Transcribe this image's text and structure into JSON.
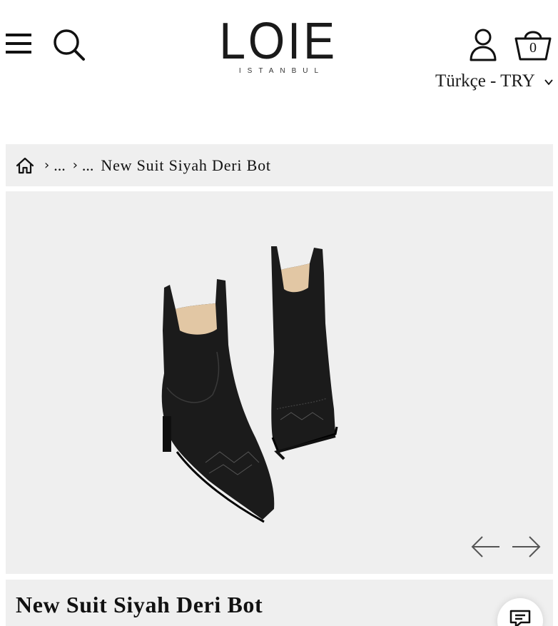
{
  "header": {
    "brand": "LOIE",
    "brand_sub": "ISTANBUL",
    "language_currency": "Türkçe - TRY",
    "cart_count": "0",
    "icons": {
      "menu": "hamburger-menu-icon",
      "search": "search-icon",
      "account": "user-icon",
      "cart": "shopping-basket-icon"
    }
  },
  "breadcrumb": {
    "home_icon": "home-icon",
    "items": [
      "...",
      "...",
      "New Suit Siyah Deri Bot"
    ]
  },
  "gallery": {
    "image_alt": "black leather western boots",
    "prev_icon": "arrow-left-icon",
    "next_icon": "arrow-right-icon"
  },
  "product": {
    "title": "New Suit Siyah Deri Bot"
  },
  "chat": {
    "icon": "chat-icon"
  },
  "colors": {
    "panel_bg": "#efefef",
    "text": "#111111",
    "boot": "#1b1b1b",
    "lining": "#e2c7a4"
  }
}
